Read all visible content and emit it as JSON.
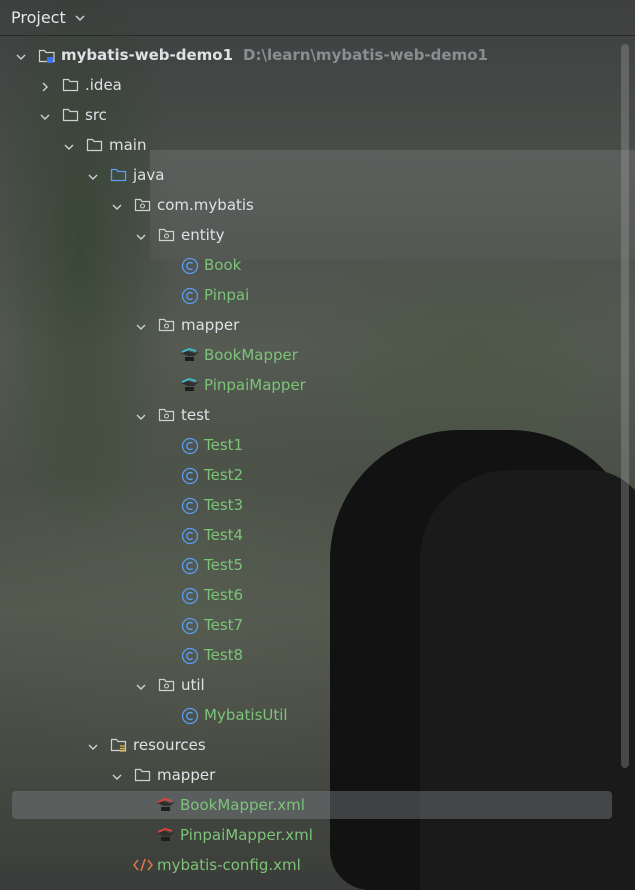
{
  "header": {
    "title": "Project"
  },
  "tree": [
    {
      "label": "mybatis-web-demo1",
      "path": "D:\\learn\\mybatis-web-demo1"
    },
    {
      "label": ".idea"
    },
    {
      "label": "src"
    },
    {
      "label": "main"
    },
    {
      "label": "java"
    },
    {
      "label": "com.mybatis"
    },
    {
      "label": "entity"
    },
    {
      "label": "Book"
    },
    {
      "label": "Pinpai"
    },
    {
      "label": "mapper"
    },
    {
      "label": "BookMapper"
    },
    {
      "label": "PinpaiMapper"
    },
    {
      "label": "test"
    },
    {
      "label": "Test1"
    },
    {
      "label": "Test2"
    },
    {
      "label": "Test3"
    },
    {
      "label": "Test4"
    },
    {
      "label": "Test5"
    },
    {
      "label": "Test6"
    },
    {
      "label": "Test7"
    },
    {
      "label": "Test8"
    },
    {
      "label": "util"
    },
    {
      "label": "MybatisUtil"
    },
    {
      "label": "resources"
    },
    {
      "label": "mapper"
    },
    {
      "label": "BookMapper.xml"
    },
    {
      "label": "PinpaiMapper.xml"
    },
    {
      "label": "mybatis-config.xml"
    }
  ]
}
